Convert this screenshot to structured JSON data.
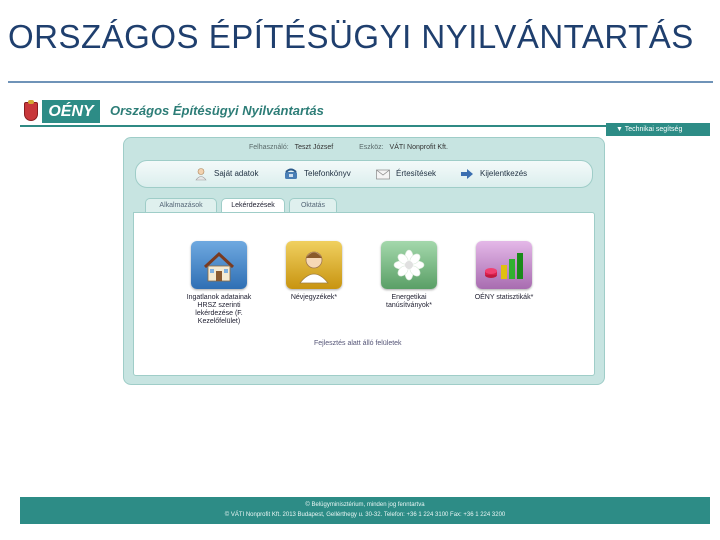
{
  "slide": {
    "title": "ORSZÁGOS ÉPÍTÉSÜGYI NYILVÁNTARTÁS"
  },
  "app": {
    "logo_text": "OÉNY",
    "title": "Országos Építésügyi Nyilvántartás",
    "support_label": "▼ Technikai segítség",
    "user_label": "Felhasználó:",
    "user_value": "Teszt József",
    "org_label": "Eszköz:",
    "org_value": "VÁTI Nonprofit Kft."
  },
  "toolbar": {
    "items": [
      {
        "label": "Saját adatok",
        "icon": "person-icon"
      },
      {
        "label": "Telefonkönyv",
        "icon": "phone-icon"
      },
      {
        "label": "Értesítések",
        "icon": "envelope-icon"
      },
      {
        "label": "Kijelentkezés",
        "icon": "arrow-right-icon"
      }
    ]
  },
  "tabs": [
    {
      "label": "Alkalmazások",
      "active": false
    },
    {
      "label": "Lekérdezések",
      "active": true
    },
    {
      "label": "Oktatás",
      "active": false
    }
  ],
  "tiles": [
    {
      "caption": "Ingatlanok adatainak HRSZ szerinti lekérdezése (F. Kezelőfelület)",
      "icon": "house-icon",
      "color": "#3a7fc4"
    },
    {
      "caption": "Névjegyzékek*",
      "icon": "person-icon",
      "color": "#d8a818"
    },
    {
      "caption": "Energetikai tanúsítványok*",
      "icon": "flower-icon",
      "color": "#6fb07a"
    },
    {
      "caption": "OÉNY statisztikák*",
      "icon": "bar-chart-icon",
      "color": "#b97fc0"
    }
  ],
  "content": {
    "footnote": "Fejlesztés alatt álló felületek"
  },
  "footer": {
    "line1": "© Belügyminisztérium, minden jog fenntartva",
    "line2": "© VÁTI Nonprofit Kft. 2013 Budapest, Gellérthegy u. 30-32. Telefon: +36 1 224 3100 Fax: +36 1 224 3200"
  }
}
